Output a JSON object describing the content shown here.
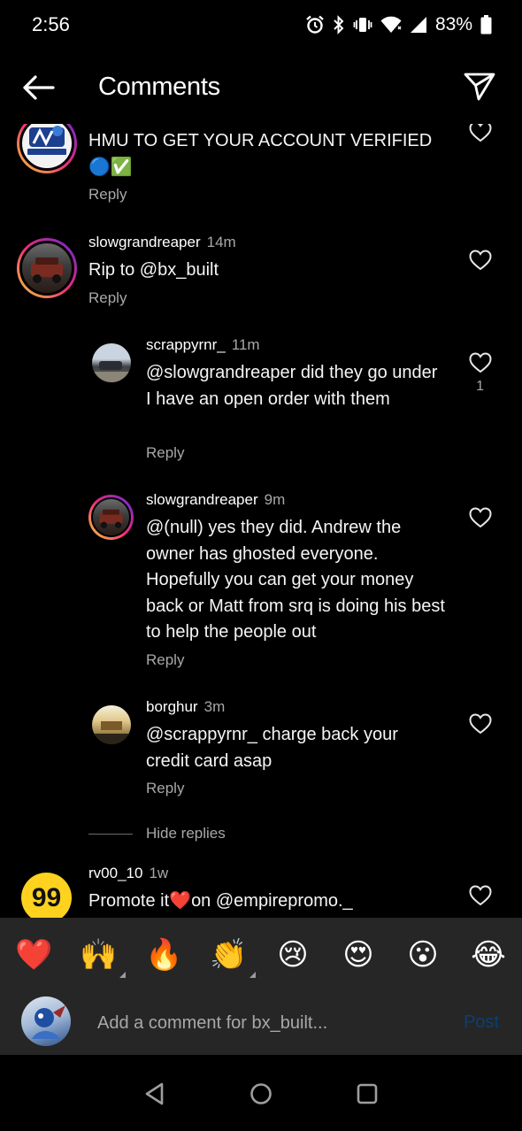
{
  "status_bar": {
    "time": "2:56",
    "battery": "83%",
    "icons": [
      "alarm-icon",
      "bluetooth-icon",
      "vibrate-icon",
      "wifi-icon",
      "signal-icon",
      "battery-icon"
    ]
  },
  "header": {
    "title": "Comments",
    "back_icon": "arrow-left-icon",
    "share_icon": "send-icon"
  },
  "comments": [
    {
      "username": "",
      "time": "",
      "text": "HMU TO GET YOUR ACCOUNT VERIFIED",
      "emoji": "🔵✅",
      "reply_label": "Reply",
      "likes": ""
    },
    {
      "username": "slowgrandreaper",
      "time": "14m",
      "text": "Rip to @bx_built",
      "reply_label": "Reply",
      "likes": ""
    },
    {
      "username": "scrappyrnr_",
      "time": "11m",
      "text": "@slowgrandreaper did they go under I have an open order with them",
      "reply_label": "Reply",
      "likes": "1"
    },
    {
      "username": "slowgrandreaper",
      "time": "9m",
      "text": "@(null) yes they did. Andrew the owner has ghosted everyone. Hopefully you can get your money back or Matt from srq is doing his best to help the people out",
      "reply_label": "Reply",
      "likes": ""
    },
    {
      "username": "borghur",
      "time": "3m",
      "text": "@scrappyrnr_ charge back your credit card asap",
      "reply_label": "Reply",
      "likes": ""
    },
    {
      "username": "rv00_10",
      "time": "1w",
      "text_before": "Promote it",
      "text_emoji": "❤️",
      "text_after": "on @empirepromo._",
      "likes": ""
    }
  ],
  "hide_replies": "Hide replies",
  "reactions": [
    "❤️",
    "🙌",
    "🔥",
    "👏",
    "😢",
    "😍",
    "😮",
    "😂"
  ],
  "composer": {
    "placeholder": "Add a comment for bx_built...",
    "post_label": "Post"
  },
  "nav": [
    "back-triangle-icon",
    "home-circle-icon",
    "recents-square-icon"
  ],
  "colors": {
    "background": "#000000",
    "reaction_bar": "#262626",
    "secondary_text": "#a8a8a8",
    "post_disabled": "#0c3f73"
  }
}
